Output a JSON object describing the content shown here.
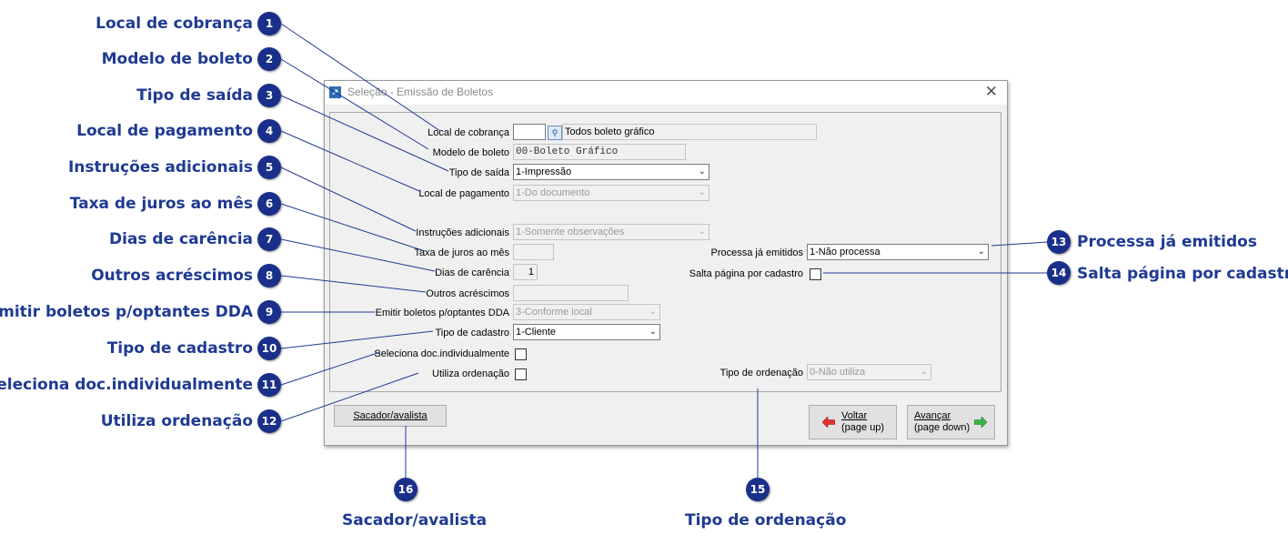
{
  "callouts": {
    "c1": {
      "num": "1",
      "label": "Local de cobrança"
    },
    "c2": {
      "num": "2",
      "label": "Modelo de boleto"
    },
    "c3": {
      "num": "3",
      "label": "Tipo de saída"
    },
    "c4": {
      "num": "4",
      "label": "Local de pagamento"
    },
    "c5": {
      "num": "5",
      "label": "Instruções adicionais"
    },
    "c6": {
      "num": "6",
      "label": "Taxa de juros ao mês"
    },
    "c7": {
      "num": "7",
      "label": "Dias de carência"
    },
    "c8": {
      "num": "8",
      "label": "Outros acréscimos"
    },
    "c9": {
      "num": "9",
      "label": "Emitir boletos p/optantes DDA"
    },
    "c10": {
      "num": "10",
      "label": "Tipo de cadastro"
    },
    "c11": {
      "num": "11",
      "label": "Seleciona doc.individualmente"
    },
    "c12": {
      "num": "12",
      "label": "Utiliza ordenação"
    },
    "c13": {
      "num": "13",
      "label": "Processa já emitidos"
    },
    "c14": {
      "num": "14",
      "label": "Salta página por cadastro"
    },
    "c15": {
      "num": "15",
      "label": "Tipo de ordenação"
    },
    "c16": {
      "num": "16",
      "label": "Sacador/avalista"
    }
  },
  "dialog": {
    "title": "Seleção - Emissão de Boletos",
    "close_glyph": "✕",
    "icon_glyph": "↗"
  },
  "form": {
    "local_cobranca": {
      "label": "Local de cobrança",
      "code": "",
      "desc": "Todos boleto gráfico"
    },
    "modelo_boleto": {
      "label": "Modelo de boleto",
      "value": "00-Boleto Gráfico"
    },
    "tipo_saida": {
      "label": "Tipo de saída",
      "value": "1-Impressão"
    },
    "local_pagamento": {
      "label": "Local de pagamento",
      "value": "1-Do documento"
    },
    "instrucoes": {
      "label": "Instruções adicionais",
      "value": "1-Somente observações"
    },
    "taxa_juros": {
      "label": "Taxa de juros ao mês",
      "value": ""
    },
    "dias_carencia": {
      "label": "Dias de carência",
      "value": "1"
    },
    "outros_acrescimos": {
      "label": "Outros acréscimos",
      "value": ""
    },
    "emitir_dda": {
      "label": "Emitir boletos p/optantes DDA",
      "value": "3-Conforme local"
    },
    "tipo_cadastro": {
      "label": "Tipo de cadastro",
      "value": "1-Cliente"
    },
    "seleciona_doc": {
      "label": "Seleciona doc.individualmente",
      "checked": false
    },
    "utiliza_ordenacao": {
      "label": "Utiliza ordenação",
      "checked": false
    },
    "processa_emitidos": {
      "label": "Processa já emitidos",
      "value": "1-Não processa"
    },
    "salta_pagina": {
      "label": "Salta página por cadastro",
      "checked": false
    },
    "tipo_ordenacao": {
      "label": "Tipo de ordenação",
      "value": "0-Não utiliza"
    }
  },
  "buttons": {
    "sacador": "Sacador/avalista",
    "voltar_line1": "Voltar",
    "voltar_line2": "(page up)",
    "avancar_line1": "Avançar",
    "avancar_line2": "(page down)"
  },
  "icons": {
    "dropdown": "chevron-down-icon",
    "lookup": "search-icon",
    "back": "arrow-left-icon",
    "forward": "arrow-right-icon"
  },
  "colors": {
    "callout_text": "#1f3a93",
    "badge_bg": "#1a2f8a",
    "leader_line": "#1f3a93",
    "back_arrow": "#e03030",
    "forward_arrow": "#3cb043"
  }
}
